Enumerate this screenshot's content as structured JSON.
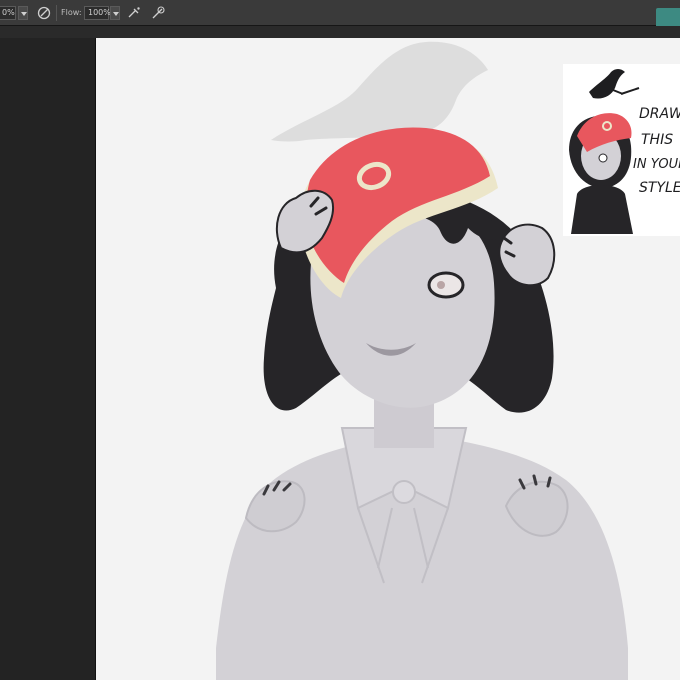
{
  "options_bar": {
    "size_value": "0%",
    "flow_label": "Flow:",
    "flow_value": "100%"
  },
  "reference": {
    "caption": [
      "DRAW",
      "THIS",
      "IN YOUR",
      "STYLE"
    ]
  },
  "colors": {
    "accent": "#3d8a82",
    "hat_red": "#e8575e",
    "hat_cream": "#ece6c9",
    "hair": "#262528",
    "skin_gray": "#d3d1d6",
    "canvas": "#f3f3f3"
  }
}
